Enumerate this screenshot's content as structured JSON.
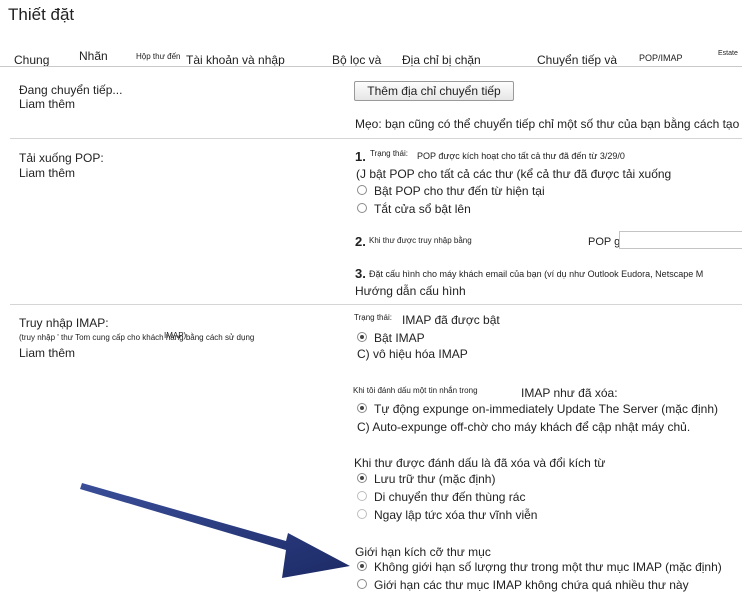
{
  "page_title": "Thiết đặt",
  "tabs": [
    {
      "label": "Chung"
    },
    {
      "label": "Nhãn"
    },
    {
      "label": "Hộp thư đến"
    },
    {
      "label": "Tài khoản và nhập"
    },
    {
      "label": "Bộ lọc và"
    },
    {
      "label": "Địa chỉ bị chặn"
    },
    {
      "label": "Chuyển tiếp và"
    },
    {
      "label": "POP/IMAP"
    },
    {
      "label": "Estate"
    }
  ],
  "forwarding": {
    "label": "Đang chuyển tiếp...",
    "learn_more": "Liam thêm",
    "add_button": "Thêm địa chỉ chuyển tiếp",
    "tip": "Mẹo: bạn cũng có thể chuyển tiếp chỉ một số thư của bạn bằng cách tạo bộ lọc!"
  },
  "pop": {
    "label": "Tải xuống POP:",
    "learn_more": "Liam thêm",
    "n1": "1.",
    "status_label": "Trạng thái:",
    "status_text": "POP được kích hoạt cho tất cả thư đã đến từ 3/29/0",
    "enable_all": "(J bật POP cho tất cả các thư (kể cả thư đã được tải xuống",
    "opt_new": "Bật POP cho thư đến từ hiện tại",
    "opt_off": "Tắt cửa sổ bật lên",
    "n2": "2.",
    "access_label": "Khi thư được truy nhập bằng",
    "access_action": "POP giữ bản sao của Gmail trong",
    "n3": "3.",
    "configure_text": "Đặt cấu hình cho máy khách email của bạn (ví dụ như Outlook Eudora, Netscape M",
    "guide_link": "Hướng dẫn cấu hình"
  },
  "imap": {
    "label": "Truy nhập IMAP:",
    "sub_text": "(truy nhập ' thư Tom cung cấp cho khách hàng bằng cách sử dụng",
    "sub_overlap": "IMAP)",
    "learn_more": "Liam thêm",
    "status_label": "Trạng thái:",
    "status_text": "IMAP đã được bật",
    "opt_enable": "Bật IMAP",
    "opt_disable": "C) vô hiệu hóa IMAP",
    "deleted_label": "Khi tôi đánh dấu một tin nhắn trong",
    "deleted_text": "IMAP như đã xóa:",
    "expunge_on": "Tự động expunge on-immediately Update The Server (mặc định)",
    "expunge_off": "C) Auto-expunge off-chờ cho máy khách để cập nhật máy chủ.",
    "expunged_heading": "Khi thư được đánh dấu là đã xóa và đổi kích từ",
    "archive": "Lưu trữ thư (mặc định)",
    "trash": "Di chuyển thư đến thùng rác",
    "delete_forever": "Ngay lập tức xóa thư vĩnh viễn",
    "folder_heading": "Giới hạn kích cỡ thư mục",
    "no_limit": "Không giới hạn số lượng thư trong một thư mục IMAP (mặc định)",
    "limit": "Giới hạn các thư mục IMAP không chứa quá nhiều thư này"
  },
  "colors": {
    "arrow": "#24367e",
    "separator": "#d5d5d5"
  }
}
